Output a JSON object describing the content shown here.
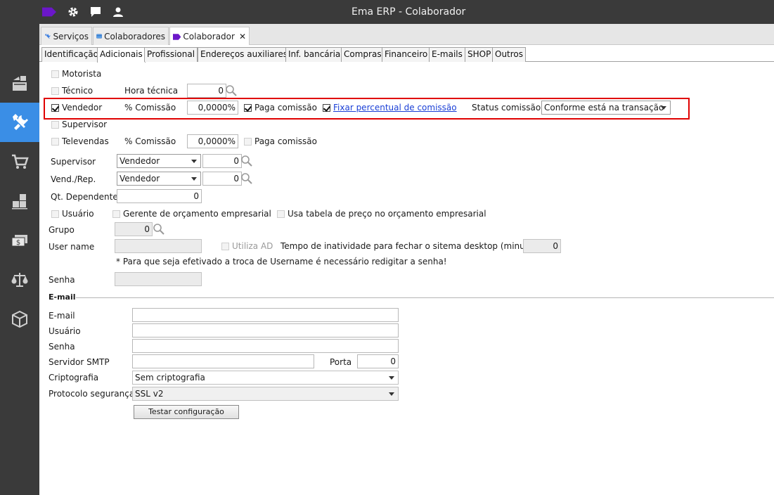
{
  "window": {
    "title": "Ema ERP - Colaborador",
    "toolbar_icons": [
      "tag-icon",
      "gear-icon",
      "chat-icon",
      "user-icon"
    ]
  },
  "sidebar": {
    "items": [
      {
        "icon": "cash-register-icon"
      },
      {
        "icon": "tools-icon",
        "active": true
      },
      {
        "icon": "cart-icon"
      },
      {
        "icon": "boxes-icon"
      },
      {
        "icon": "money-icon"
      },
      {
        "icon": "scale-icon"
      },
      {
        "icon": "package-icon"
      }
    ]
  },
  "doc_tabs": [
    {
      "label": "Serviços",
      "icon": "tools-icon"
    },
    {
      "label": "Colaboradores",
      "icon": "card-icon"
    },
    {
      "label": "Colaborador",
      "icon": "tag-icon",
      "close": "✕"
    }
  ],
  "sub_tabs": [
    "Identificação",
    "Adicionais",
    "Profissional",
    "Endereços auxiliares",
    "Inf. bancária",
    "Compras",
    "Financeiro",
    "E-mails",
    "SHOP",
    "Outros"
  ],
  "form": {
    "motorista": "Motorista",
    "tecnico": "Técnico",
    "hora_tecnica_label": "Hora técnica",
    "hora_tecnica_value": "0",
    "vendedor": "Vendedor",
    "comissao_label": "% Comissão",
    "comissao_value": "0,0000%",
    "paga_comissao": "Paga comissão",
    "fixar_percentual": "Fixar percentual de comissão",
    "status_comissao_label": "Status comissão",
    "status_comissao_value": "Conforme está na transação",
    "supervisor_cb": "Supervisor",
    "televendas": "Televendas",
    "comissao2_label": "% Comissão",
    "comissao2_value": "0,0000%",
    "paga_comissao2": "Paga comissão",
    "supervisor_label": "Supervisor",
    "supervisor_select": "Vendedor",
    "supervisor_value": "0",
    "vend_rep_label": "Vend./Rep.",
    "vend_rep_select": "Vendedor",
    "vend_rep_value": "0",
    "qt_dependentes_label": "Qt. Dependentes",
    "qt_dependentes_value": "0",
    "usuario_cb": "Usuário",
    "gerente_cb": "Gerente de orçamento empresarial",
    "tabela_preco_cb": "Usa tabela de preço no orçamento empresarial",
    "grupo_label": "Grupo",
    "grupo_value": "0",
    "username_label": "User name",
    "utiliza_ad": "Utiliza AD",
    "inatividade_label": "Tempo de inatividade para fechar o sitema desktop (minutos)",
    "inatividade_value": "0",
    "username_note": "* Para que seja efetivado a troca de Username é necessário redigitar a senha!",
    "senha_label": "Senha"
  },
  "email": {
    "section_title": "E-mail",
    "email_label": "E-mail",
    "usuario_label": "Usuário",
    "senha_label": "Senha",
    "smtp_label": "Servidor SMTP",
    "porta_label": "Porta",
    "porta_value": "0",
    "cripto_label": "Criptografia",
    "cripto_value": "Sem criptografia",
    "protocolo_label": "Protocolo segurança",
    "protocolo_value": "SSL v2",
    "test_button": "Testar configuração"
  },
  "colors": {
    "titlebar": "#3a3a3a",
    "sidebar_active": "#3a8ee6",
    "highlight": "#e00000",
    "tag": "#6b17c9"
  }
}
